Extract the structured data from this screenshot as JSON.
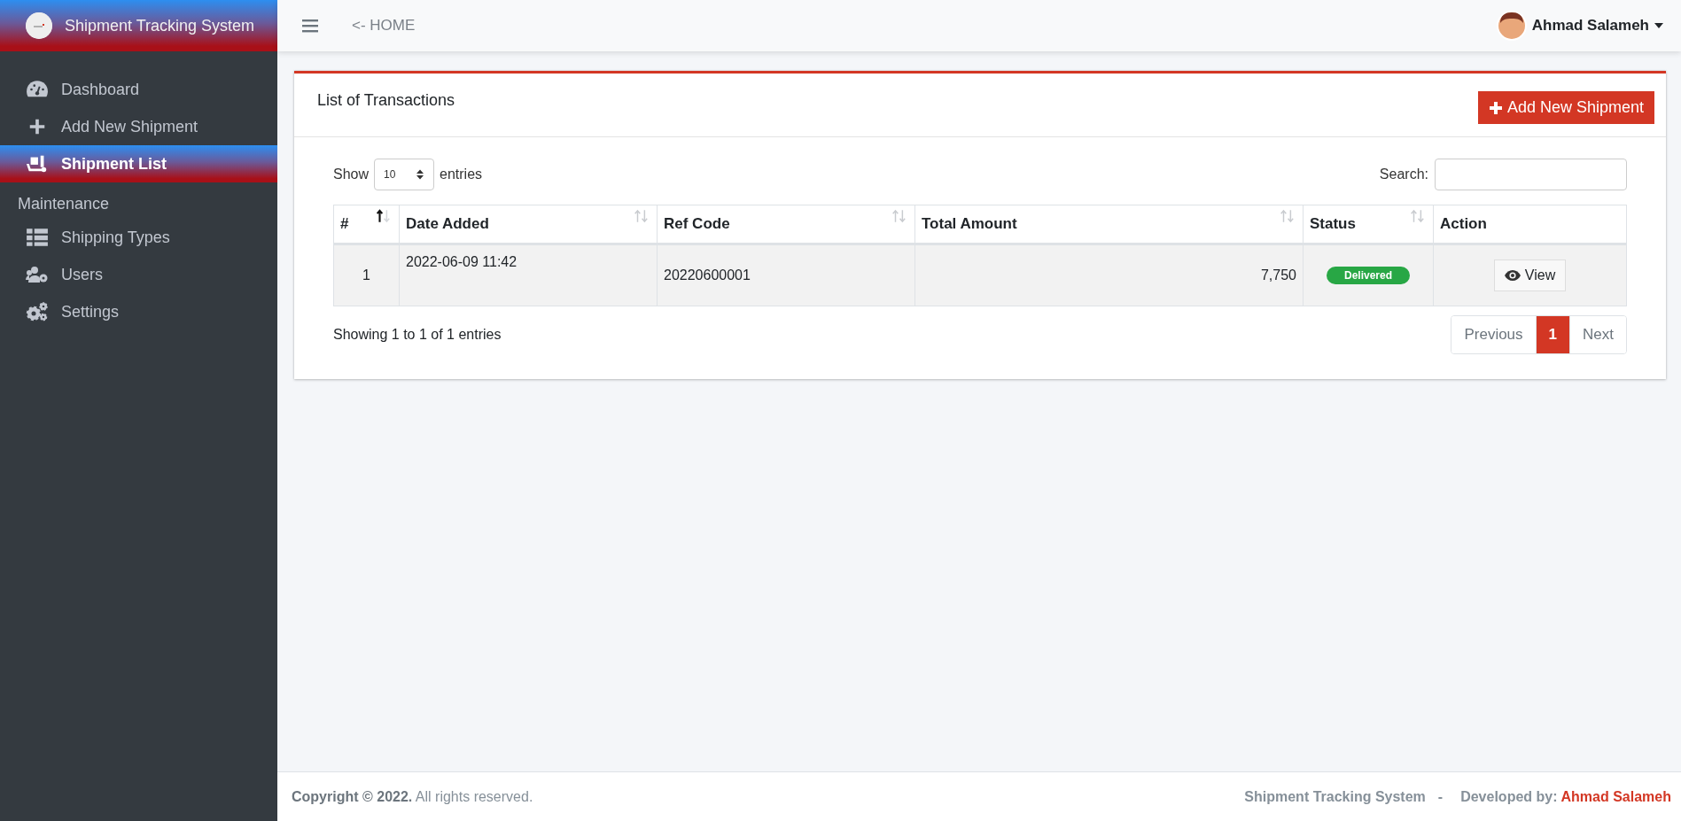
{
  "sidebar": {
    "brand": "Shipment Tracking System",
    "items": [
      {
        "kind": "link",
        "label": "Dashboard",
        "selected": false
      },
      {
        "kind": "link",
        "label": "Add New Shipment",
        "selected": false
      },
      {
        "kind": "link",
        "label": "Shipment List",
        "selected": true
      },
      {
        "kind": "heading",
        "label": "Maintenance"
      },
      {
        "kind": "link",
        "label": "Shipping Types",
        "selected": false
      },
      {
        "kind": "link",
        "label": "Users",
        "selected": false
      },
      {
        "kind": "link",
        "label": "Settings",
        "selected": false
      }
    ]
  },
  "header": {
    "home_link": "<- HOME",
    "user_name": "Ahmad Salameh"
  },
  "card": {
    "title": "List of Transactions",
    "add_button": "Add New Shipment"
  },
  "table_controls": {
    "show_label": "Show",
    "page_size": "10",
    "entries_label": "entries",
    "search_label": "Search:"
  },
  "table": {
    "columns": [
      {
        "label": "#",
        "sortable": true,
        "sorted": true
      },
      {
        "label": "Date Added",
        "sortable": true,
        "sorted": false
      },
      {
        "label": "Ref Code",
        "sortable": true,
        "sorted": false
      },
      {
        "label": "Total Amount",
        "sortable": true,
        "sorted": false
      },
      {
        "label": "Status",
        "sortable": true,
        "sorted": false
      },
      {
        "label": "Action",
        "sortable": false
      }
    ],
    "rows": [
      {
        "index": "1",
        "date_added": "2022-06-09 11:42",
        "ref_code": "20220600001",
        "total_amount": "7,750",
        "status": "Delivered",
        "action": "View"
      }
    ]
  },
  "info": "Showing 1 to 1 of 1 entries",
  "pagination": [
    {
      "label": "Previous",
      "selected": false
    },
    {
      "label": "1",
      "selected": true
    },
    {
      "label": "Next",
      "selected": false
    }
  ],
  "footer": {
    "copyright": "**Copyright © 2022.** All rights reserved.",
    "system_name": "Shipment Tracking System",
    "separator": "-",
    "developed_label": "Developed by:",
    "developer": "Ahmad Salameh"
  }
}
